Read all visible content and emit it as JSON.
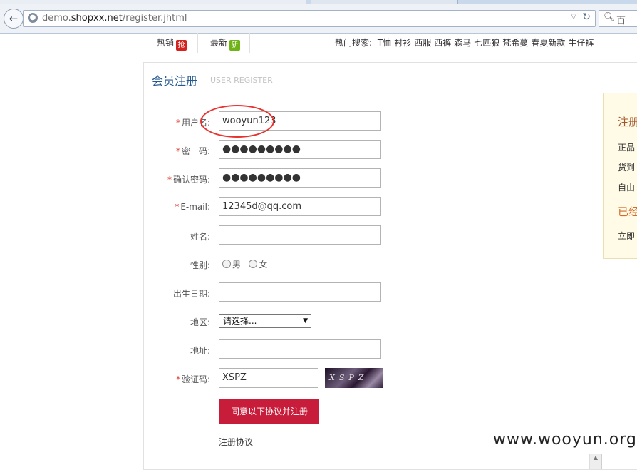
{
  "browser": {
    "url_prefix": "demo.",
    "url_domain": "shopxx.net",
    "url_path": "/register.jhtml",
    "search_placeholder": "百"
  },
  "nav": {
    "hot_label": "热销",
    "hot_badge": "抢",
    "new_label": "最新",
    "new_badge": "新",
    "hot_search_label": "热门搜索:",
    "hot_search_terms": [
      "T恤",
      "衬衫",
      "西服",
      "西裤",
      "森马",
      "七匹狼",
      "梵希蔓",
      "春夏新款",
      "牛仔裤"
    ]
  },
  "panel": {
    "title": "会员注册",
    "subtitle": "USER REGISTER"
  },
  "form": {
    "username_label": "用户名:",
    "username_value": "wooyun123",
    "password_label": "密　码:",
    "password_value": "●●●●●●●●●",
    "confirm_label": "确认密码:",
    "confirm_value": "●●●●●●●●●",
    "email_label": "E-mail:",
    "email_value": "12345d@qq.com",
    "name_label": "姓名:",
    "gender_label": "性别:",
    "gender_male": "男",
    "gender_female": "女",
    "birth_label": "出生日期:",
    "region_label": "地区:",
    "region_value": "请选择...",
    "address_label": "地址:",
    "captcha_label": "验证码:",
    "captcha_value": "XSPZ",
    "captcha_image_text": "XSPZ",
    "submit_label": "同意以下协议并注册",
    "agreement_title": "注册协议",
    "required_mark": "*"
  },
  "side": {
    "title1": "注册",
    "line1": "正品",
    "line2": "货到",
    "line3": "自由",
    "title2": "已经",
    "line4": "立即"
  },
  "watermark": "www.wooyun.org"
}
